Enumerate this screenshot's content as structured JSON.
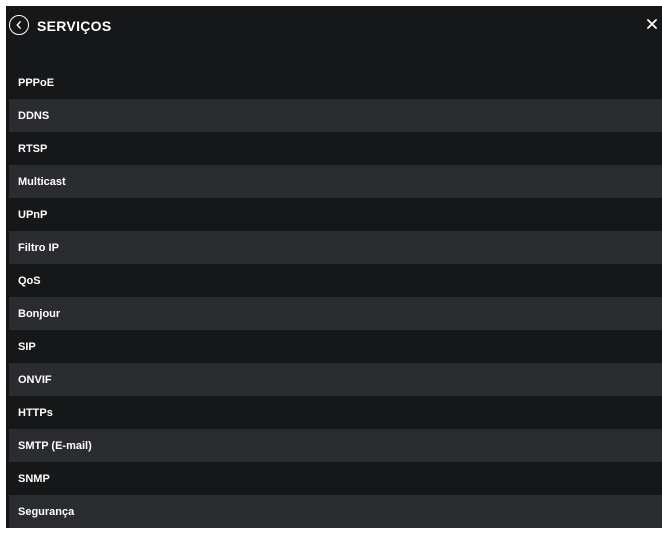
{
  "header": {
    "title": "SERVIÇOS"
  },
  "menu": {
    "items": [
      {
        "label": "PPPoE"
      },
      {
        "label": "DDNS"
      },
      {
        "label": "RTSP"
      },
      {
        "label": "Multicast"
      },
      {
        "label": "UPnP"
      },
      {
        "label": "Filtro IP"
      },
      {
        "label": "QoS"
      },
      {
        "label": "Bonjour"
      },
      {
        "label": "SIP"
      },
      {
        "label": "ONVIF"
      },
      {
        "label": "HTTPs"
      },
      {
        "label": "SMTP (E-mail)"
      },
      {
        "label": "SNMP"
      },
      {
        "label": "Segurança"
      }
    ]
  },
  "colors": {
    "panel_background": "#161719",
    "alt_row_background": "#2a2c30",
    "text": "#ffffff"
  },
  "icons": {
    "back": "chevron-left-circle-icon",
    "close": "close-icon"
  }
}
